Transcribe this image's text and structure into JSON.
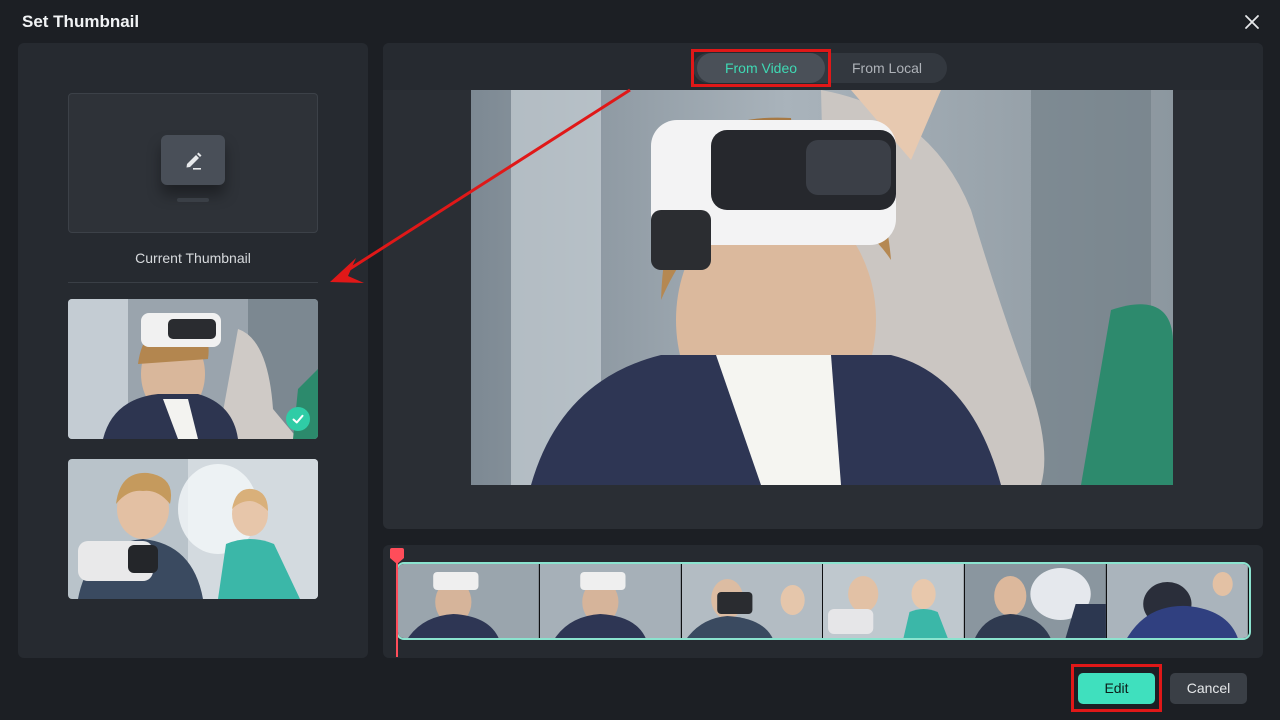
{
  "dialog": {
    "title": "Set Thumbnail"
  },
  "left_panel": {
    "current_thumbnail_label": "Current Thumbnail",
    "thumbnails": [
      {
        "selected": true
      },
      {
        "selected": false
      }
    ]
  },
  "tabs": [
    {
      "label": "From Video",
      "active": true
    },
    {
      "label": "From Local",
      "active": false
    }
  ],
  "buttons": {
    "edit": "Edit",
    "cancel": "Cancel"
  },
  "colors": {
    "accent": "#3fe0be",
    "highlight": "#e01818",
    "playhead": "#ff4d5a"
  },
  "icons": [
    "close-icon",
    "pencil-icon",
    "check-icon"
  ]
}
